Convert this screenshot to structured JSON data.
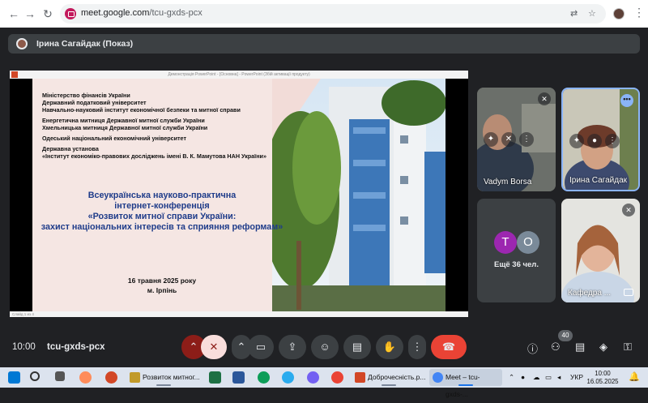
{
  "browser": {
    "url_host": "meet.google.com",
    "url_path": "/tcu-gxds-pcx"
  },
  "presenter": {
    "name": "Ірина Сагайдак (Показ)"
  },
  "slide": {
    "orgs": [
      [
        "Міністерство фінансів України",
        "Державний податковий університет",
        "Навчально-науковий інститут економічної безпеки та митної справи"
      ],
      [
        "Енергетична митниця Державної митної служби України",
        "Хмельницька митниця Державної митної служби України"
      ],
      [
        "Одеський національний економічний університет"
      ],
      [
        "Державна установа",
        "«Інститут економіко-правових досліджень імені В. К. Мамутова НАН України»"
      ]
    ],
    "title_lines": [
      "Всеукраїнська науково-практична",
      "інтернет-конференція",
      "«Розвиток митної справи України:",
      "захист національних інтересів та сприяння реформам»"
    ],
    "date_line": "16 травня 2025 року",
    "place_line": "м. Ірпінь",
    "ppt_header": "Демонстрація PowerPoint - [Основна] - PowerPoint (Збій активації продукту)",
    "ppt_footer": "Слайд 1 из 4"
  },
  "participants": {
    "tile1_name": "Vadym Borsa",
    "tile2_name": "Ірина Сагайдак",
    "more_label": "Ещё 36 чел.",
    "avatar_t": "T",
    "avatar_o": "O",
    "avatar_t_color": "#9c27b0",
    "avatar_o_color": "#7a8a99",
    "tile4_name": "Кафедра ..."
  },
  "controls": {
    "time": "10:00",
    "meeting_code": "tcu-gxds-pcx",
    "participants_count": "40"
  },
  "taskbar": {
    "apps": [
      {
        "label": "Розвиток митног...",
        "color": "#c19a2a",
        "icon": "folder-icon"
      },
      {
        "label": "Доброчесність.р...",
        "color": "#d24726",
        "icon": "pdf-icon"
      },
      {
        "label": "Meet – tcu-gxds-...",
        "color": "#4285f4",
        "icon": "chrome-icon"
      }
    ],
    "lang": "УКР",
    "clock_time": "10:00",
    "clock_date": "16.05.2025"
  }
}
